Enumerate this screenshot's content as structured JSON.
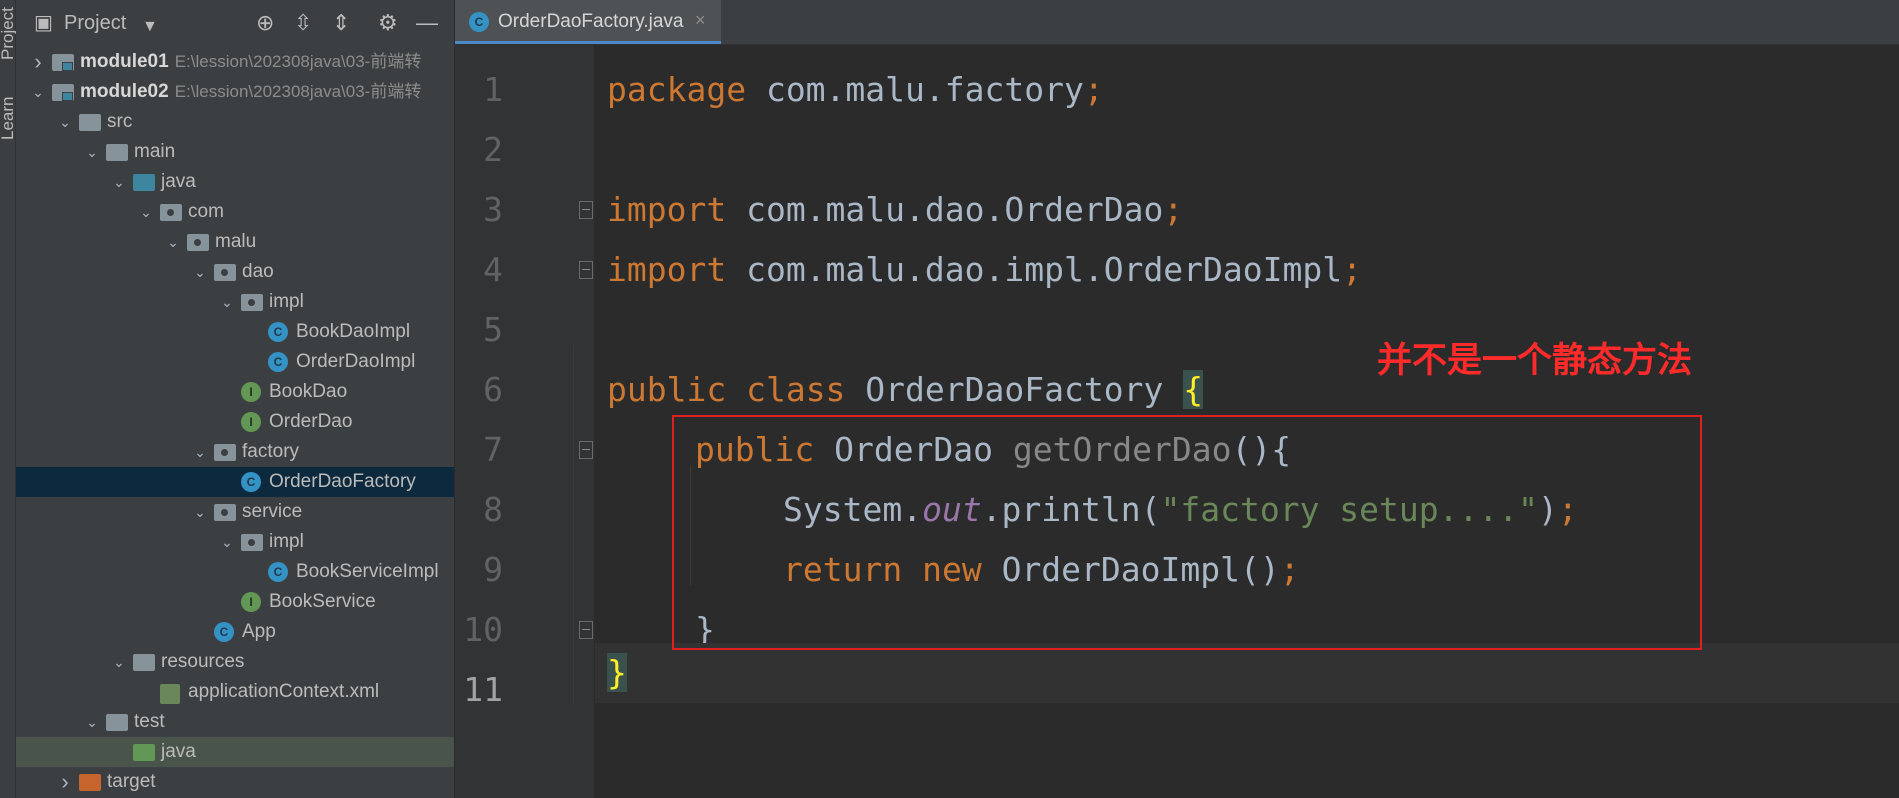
{
  "side_tabs": [
    "Project",
    "Learn"
  ],
  "panel": {
    "title": "Project",
    "icons": [
      "crosshair-icon",
      "expand-all-icon",
      "collapse-all-icon",
      "gear-icon",
      "minimize-icon"
    ]
  },
  "tree": [
    {
      "label": "module01",
      "path": "E:\\lession\\202308java\\03-前端转",
      "indent": 0,
      "arrow": "›",
      "icon": "module",
      "bold": true
    },
    {
      "label": "module02",
      "path": "E:\\lession\\202308java\\03-前端转",
      "indent": 0,
      "arrow": "⌄",
      "icon": "module",
      "bold": true
    },
    {
      "label": "src",
      "indent": 1,
      "arrow": "⌄",
      "icon": "folder"
    },
    {
      "label": "main",
      "indent": 2,
      "arrow": "⌄",
      "icon": "folder"
    },
    {
      "label": "java",
      "indent": 3,
      "arrow": "⌄",
      "icon": "folder-blue"
    },
    {
      "label": "com",
      "indent": 4,
      "arrow": "⌄",
      "icon": "package"
    },
    {
      "label": "malu",
      "indent": 5,
      "arrow": "⌄",
      "icon": "package"
    },
    {
      "label": "dao",
      "indent": 6,
      "arrow": "⌄",
      "icon": "package"
    },
    {
      "label": "impl",
      "indent": 7,
      "arrow": "⌄",
      "icon": "package"
    },
    {
      "label": "BookDaoImpl",
      "indent": 8,
      "icon": "class"
    },
    {
      "label": "OrderDaoImpl",
      "indent": 8,
      "icon": "class"
    },
    {
      "label": "BookDao",
      "indent": 7,
      "icon": "interface"
    },
    {
      "label": "OrderDao",
      "indent": 7,
      "icon": "interface"
    },
    {
      "label": "factory",
      "indent": 6,
      "arrow": "⌄",
      "icon": "package"
    },
    {
      "label": "OrderDaoFactory",
      "indent": 7,
      "icon": "class",
      "selected": true
    },
    {
      "label": "service",
      "indent": 6,
      "arrow": "⌄",
      "icon": "package"
    },
    {
      "label": "impl",
      "indent": 7,
      "arrow": "⌄",
      "icon": "package"
    },
    {
      "label": "BookServiceImpl",
      "indent": 8,
      "icon": "class"
    },
    {
      "label": "BookService",
      "indent": 7,
      "icon": "interface"
    },
    {
      "label": "App",
      "indent": 6,
      "icon": "app-class"
    },
    {
      "label": "resources",
      "indent": 3,
      "arrow": "⌄",
      "icon": "folder-res"
    },
    {
      "label": "applicationContext.xml",
      "indent": 4,
      "icon": "xml"
    },
    {
      "label": "test",
      "indent": 2,
      "arrow": "⌄",
      "icon": "folder"
    },
    {
      "label": "java",
      "indent": 3,
      "icon": "folder-green",
      "highlight": true
    },
    {
      "label": "target",
      "indent": 1,
      "arrow": "›",
      "icon": "folder-orange"
    }
  ],
  "editor": {
    "tab_label": "OrderDaoFactory.java",
    "tab_close": "×",
    "line_numbers": [
      "1",
      "2",
      "3",
      "4",
      "5",
      "6",
      "7",
      "8",
      "9",
      "10",
      "11"
    ],
    "current_line": "11",
    "code": {
      "l1_kw": "package",
      "l1_rest": " com.malu.factory",
      "l1_semi": ";",
      "l3_kw": "import",
      "l3_rest": " com.malu.dao.OrderDao",
      "l3_semi": ";",
      "l4_kw": "import",
      "l4_rest": " com.malu.dao.impl.OrderDaoImpl",
      "l4_semi": ";",
      "l6_kw1": "public",
      "l6_kw2": " class",
      "l6_rest": " OrderDaoFactory ",
      "l6_brace": "{",
      "l7_kw": "public",
      "l7_type": " OrderDao ",
      "l7_method": "getOrderDao",
      "l7_rest": "(){",
      "l8_a": "System.",
      "l8_field": "out",
      "l8_b": ".println(",
      "l8_str": "\"factory setup....\"",
      "l8_c": ")",
      "l8_semi": ";",
      "l9_kw1": "return",
      "l9_kw2": " new",
      "l9_rest": " OrderDaoImpl()",
      "l9_semi": ";",
      "l10": "}",
      "l11_brace": "}"
    }
  },
  "annotation": {
    "note": "并不是一个静态方法",
    "color": "#e02020"
  }
}
